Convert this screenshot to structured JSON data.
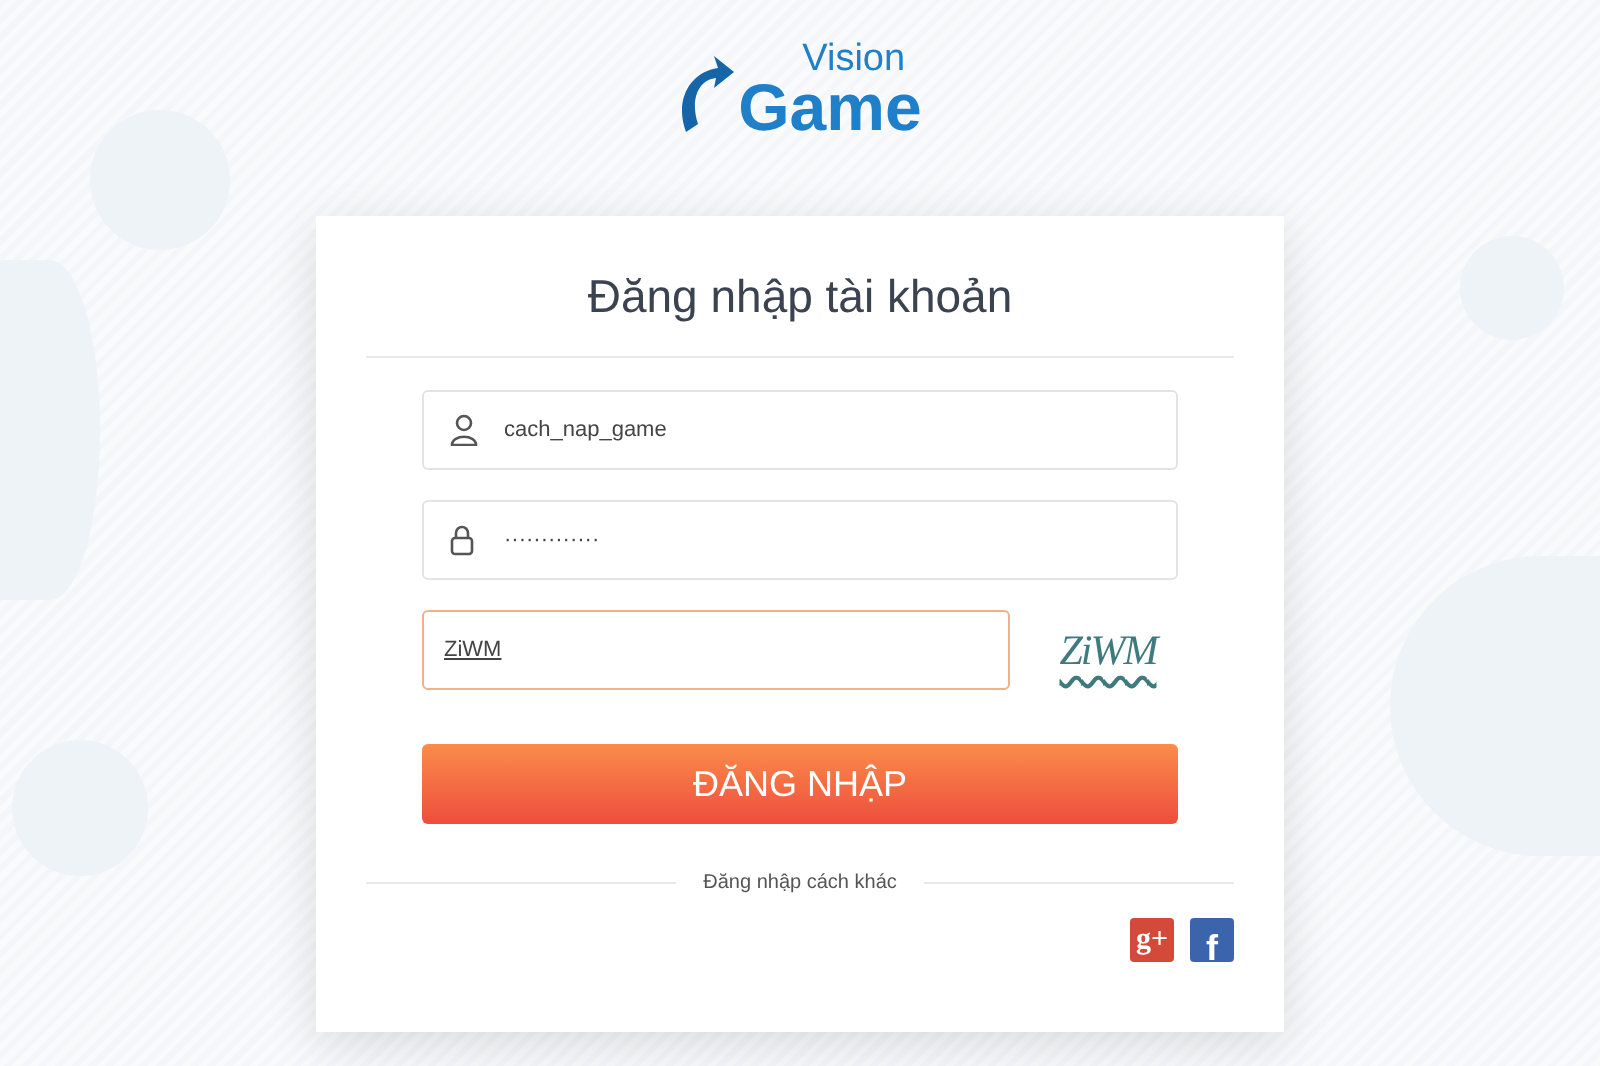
{
  "logo": {
    "top": "Vision",
    "bottom": "Game"
  },
  "login_card": {
    "title": "Đăng nhập tài khoản",
    "fields": [
      {
        "kind": "username",
        "value": "cach_nap_game",
        "focused": false
      },
      {
        "kind": "password",
        "value": "·············",
        "focused": false
      },
      {
        "kind": "captcha",
        "value": "ZiWM",
        "focused": true,
        "captcha_text": "ZiWM"
      }
    ],
    "submit": "ĐĂNG NHẬP",
    "alt_label": "Đăng nhập cách khác",
    "social": [
      {
        "kind": "google",
        "label": "g+"
      },
      {
        "kind": "facebook",
        "label": "f"
      }
    ]
  }
}
